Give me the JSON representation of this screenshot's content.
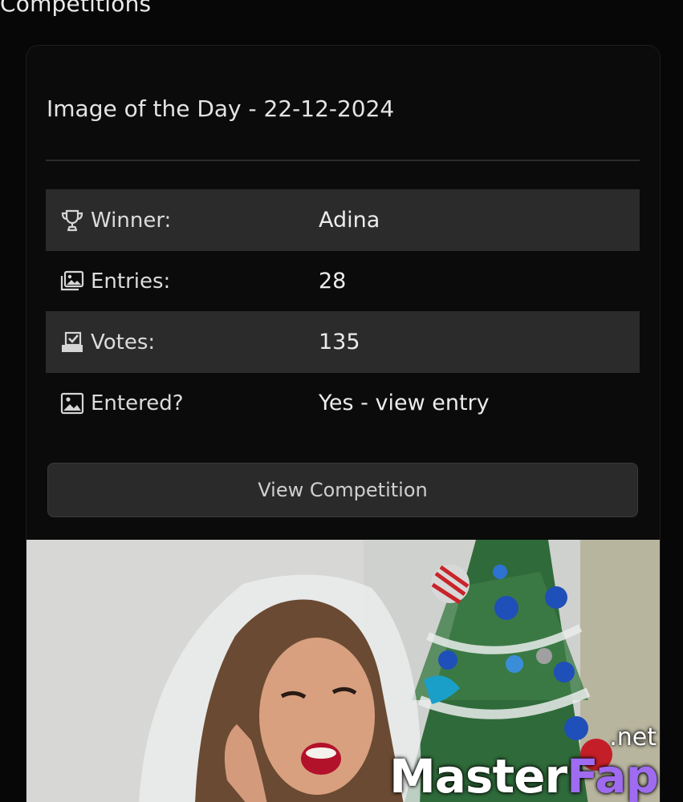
{
  "section": {
    "heading": "Competitions"
  },
  "card": {
    "title": "Image of the Day - 22-12-2024",
    "stats": [
      {
        "icon": "trophy-icon",
        "label": "Winner:",
        "value": "Adina"
      },
      {
        "icon": "images-icon",
        "label": "Entries:",
        "value": "28"
      },
      {
        "icon": "vote-box-icon",
        "label": "Votes:",
        "value": "135"
      },
      {
        "icon": "image-icon",
        "label": "Entered?",
        "value": "Yes - view entry"
      }
    ],
    "button_label": "View Competition"
  },
  "watermark": {
    "brand_part1": "Master",
    "brand_part2": "Fap",
    "tld": ".net",
    "accent_color": "#9f6bf0"
  }
}
